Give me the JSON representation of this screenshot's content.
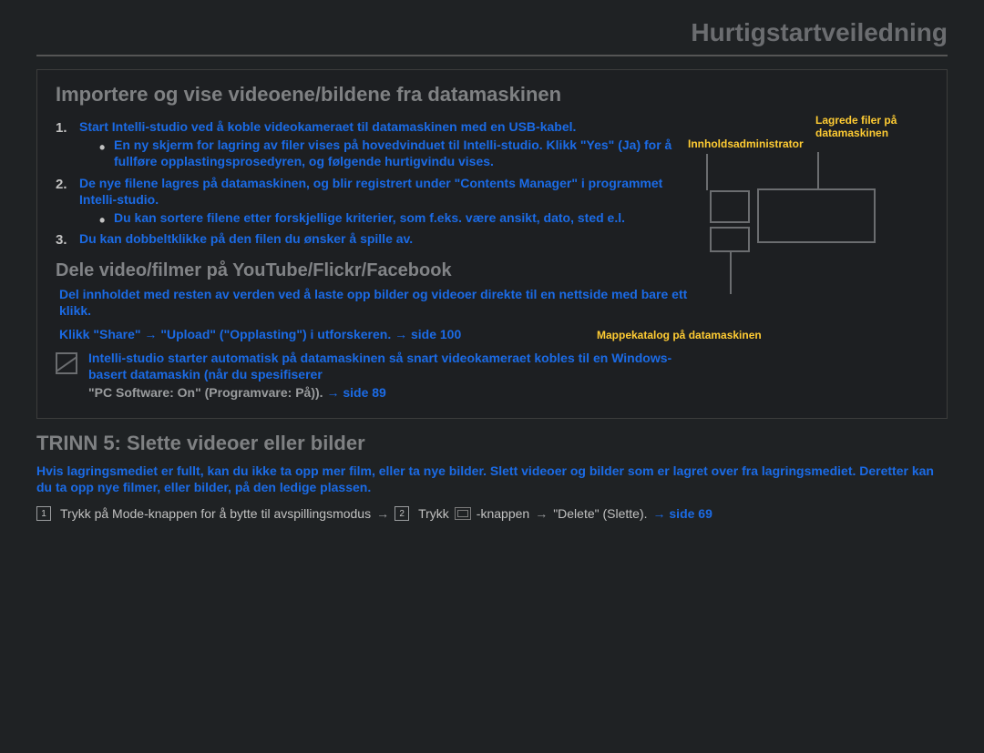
{
  "header": {
    "title": "Hurtigstartveiledning"
  },
  "section1": {
    "title": "Importere og vise videoene/bildene fra datamaskinen",
    "steps": [
      {
        "text": "Start Intelli-studio ved å koble videokameraet til datamaskinen med en USB-kabel.",
        "bullets": [
          "En ny skjerm for lagring av filer vises på hovedvinduet til Intelli-studio. Klikk \"Yes\" (Ja) for å fullføre opplastingsprosedyren, og følgende hurtigvindu vises."
        ]
      },
      {
        "text": "De nye filene lagres på datamaskinen, og blir registrert under \"Contents Manager\" i programmet Intelli-studio.",
        "bullets": [
          "Du kan sortere filene etter forskjellige kriterier, som f.eks. være ansikt, dato, sted e.l."
        ]
      },
      {
        "text": "Du kan dobbeltklikke på den filen du ønsker å spille av.",
        "bullets": []
      }
    ],
    "diagram": {
      "labels": {
        "saved": "Lagrede filer på datamaskinen",
        "contents": "Innholdsadministrator",
        "folder": "Mappekatalog på datamaskinen"
      }
    },
    "share": {
      "title": "Dele video/filmer på YouTube/Flickr/Facebook",
      "text": "Del innholdet med resten av verden ved å laste opp bilder og videoer direkte til en nettside med bare ett klikk.",
      "click_line": "Klikk \"Share\" → \"Upload\" (\"Opplasting\") i utforskeren. → side 100"
    },
    "note": {
      "line1": "Intelli-studio starter automatisk på datamaskinen så snart videokameraet kobles til en Windows-basert datamaskin (når du spesifiserer",
      "line2_pre": "\"PC Software: On\" (Programvare: På)).",
      "line2_ref": "→ side 89"
    }
  },
  "section2": {
    "title": "TRINN 5: Slette videoer eller bilder",
    "body": "Hvis lagringsmediet er fullt, kan du ikke ta opp mer film, eller ta nye bilder. Slett videoer og bilder som er lagret over fra lagringsmediet. Deretter kan du ta opp nye filmer, eller bilder, på den ledige plassen.",
    "step_parts": {
      "a": "Trykk på Mode-knappen for å bytte til avspillingsmodus",
      "b": "Trykk",
      "c": "-knappen",
      "d": "\"Delete\" (Slette).",
      "ref": "→ side 69"
    }
  }
}
